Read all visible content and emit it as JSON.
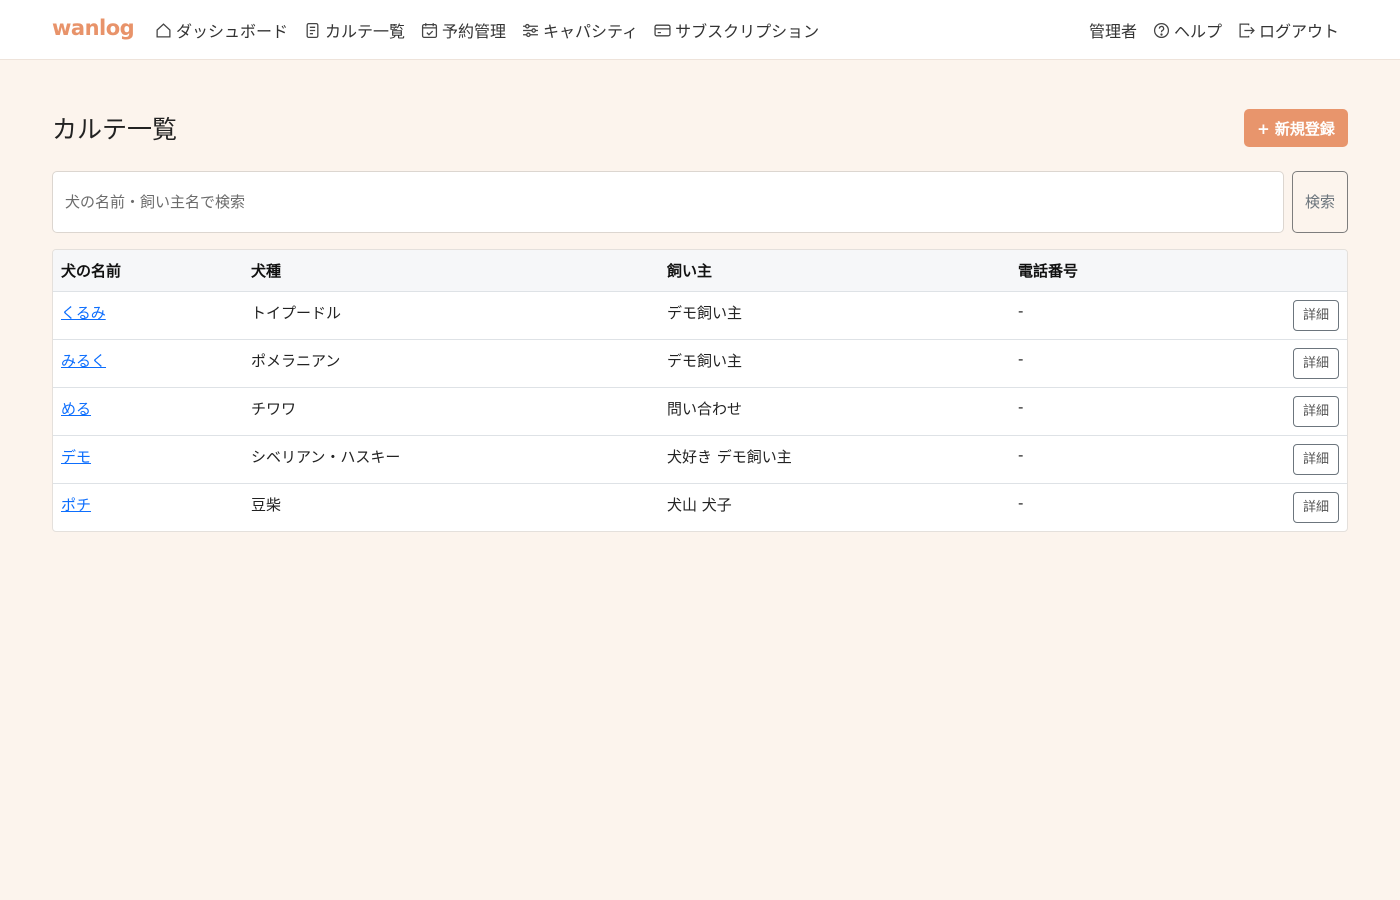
{
  "brand": "wanlog",
  "nav": {
    "dashboard": "ダッシュボード",
    "karte_list": "カルテ一覧",
    "reservations": "予約管理",
    "capacity": "キャパシティ",
    "subscription": "サブスクリプション",
    "admin": "管理者",
    "help": "ヘルプ",
    "logout": "ログアウト"
  },
  "page": {
    "title": "カルテ一覧",
    "new_button": "+ 新規登録"
  },
  "search": {
    "placeholder": "犬の名前・飼い主名で検索",
    "button": "検索"
  },
  "table": {
    "headers": [
      "犬の名前",
      "犬種",
      "飼い主",
      "電話番号"
    ],
    "detail_label": "詳細",
    "rows": [
      {
        "name": "くるみ",
        "breed": "トイプードル",
        "owner": "デモ飼い主",
        "phone": "-"
      },
      {
        "name": "みるく",
        "breed": "ポメラニアン",
        "owner": "デモ飼い主",
        "phone": "-"
      },
      {
        "name": "める",
        "breed": "チワワ",
        "owner": "問い合わせ",
        "phone": "-"
      },
      {
        "name": "デモ",
        "breed": "シベリアン・ハスキー",
        "owner": "犬好き デモ飼い主",
        "phone": "-"
      },
      {
        "name": "ポチ",
        "breed": "豆柴",
        "owner": "犬山 犬子",
        "phone": "-"
      }
    ]
  },
  "colors": {
    "brand": "#e8936a",
    "primary_button": "#e8956c",
    "background": "#fcf4ed",
    "link": "#0d6efd"
  }
}
